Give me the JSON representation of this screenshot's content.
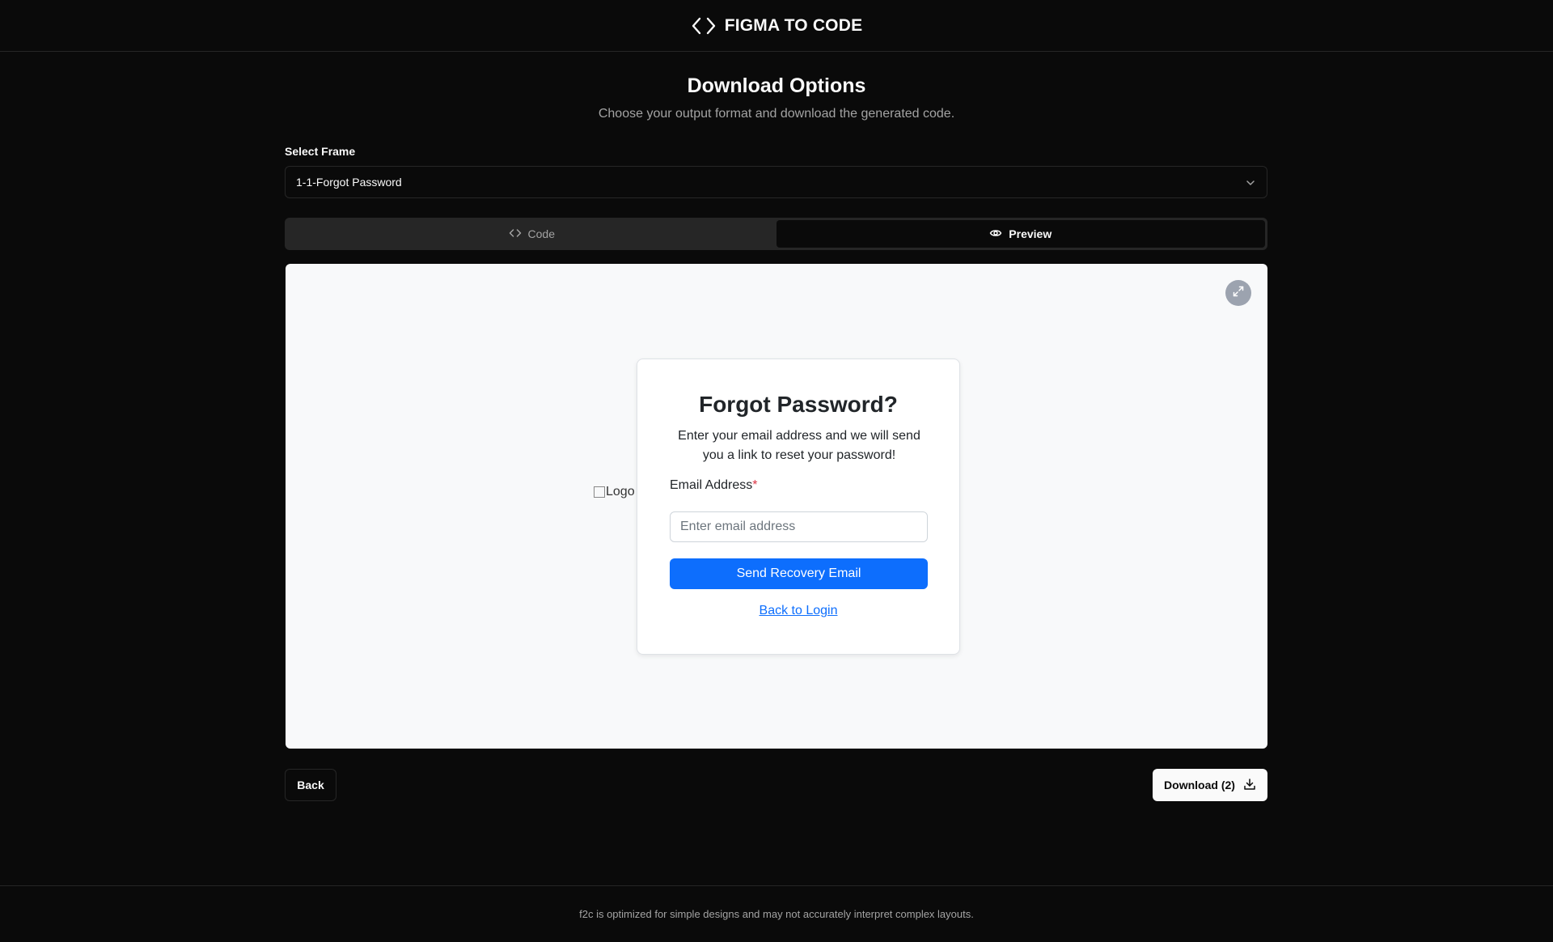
{
  "header": {
    "brand": "FIGMA TO CODE",
    "icon": "code-brackets-icon"
  },
  "page": {
    "title": "Download Options",
    "subtitle": "Choose your output format and download the generated code."
  },
  "frame_select": {
    "label": "Select Frame",
    "value": "1-1-Forgot Password"
  },
  "tabs": [
    {
      "label": "Code",
      "icon": "code-icon",
      "active": false
    },
    {
      "label": "Preview",
      "icon": "eye-icon",
      "active": true
    }
  ],
  "preview": {
    "logo_alt": "Logo",
    "card": {
      "title": "Forgot Password?",
      "description": "Enter your email address and we will send you a link to reset your password!",
      "email_label": "Email Address",
      "required_mark": "*",
      "email_placeholder": "Enter email address",
      "submit_label": "Send Recovery Email",
      "back_link": "Back to Login"
    }
  },
  "actions": {
    "back_label": "Back",
    "download_label": "Download (2)"
  },
  "footer": {
    "text": "f2c is optimized for simple designs and may not accurately interpret complex layouts."
  },
  "colors": {
    "background": "#0a0a0a",
    "primary_button": "#0d6efd",
    "required": "#dc3545"
  }
}
